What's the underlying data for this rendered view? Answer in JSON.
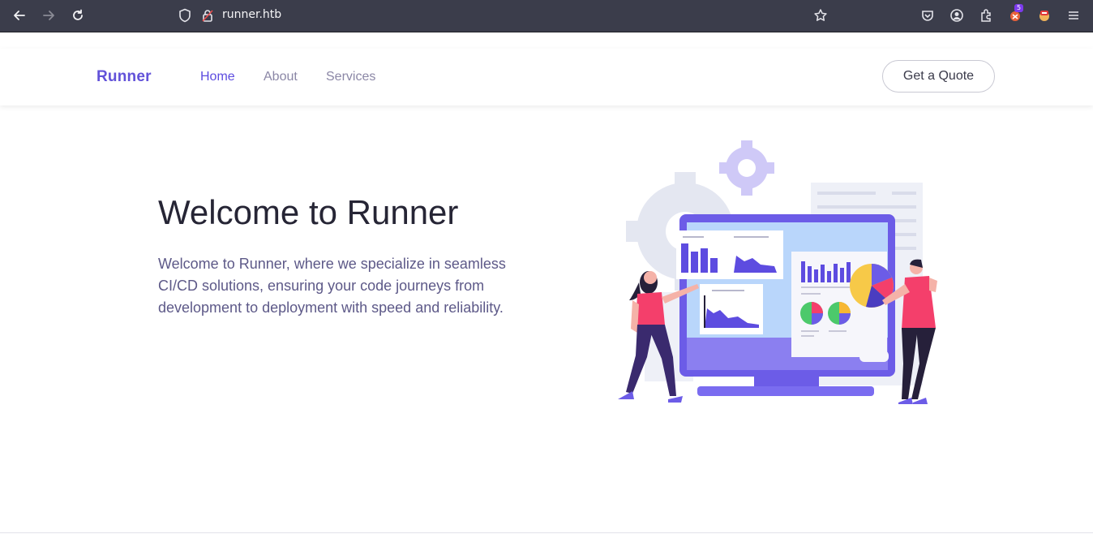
{
  "browser": {
    "url": "runner.htb",
    "extension_badge": "5",
    "icons": [
      "back-icon",
      "forward-icon",
      "reload-icon",
      "shield-icon",
      "lock-icon",
      "star-icon",
      "pocket-icon",
      "account-icon",
      "extensions-icon",
      "extension-icon",
      "extension-icon",
      "menu-icon"
    ]
  },
  "navbar": {
    "brand": "Runner",
    "links": [
      {
        "label": "Home",
        "active": true
      },
      {
        "label": "About",
        "active": false
      },
      {
        "label": "Services",
        "active": false
      }
    ],
    "cta": "Get a Quote"
  },
  "hero": {
    "title": "Welcome to Runner",
    "text": "Welcome to Runner, where we specialize in seamless CI/CD solutions, ensuring your code journeys from development to deployment with speed and reliability."
  },
  "colors": {
    "brand": "#6252d9",
    "chrome": "#3b3d4b",
    "accent_pink": "#f43f6b",
    "accent_purple": "#6c5ce7"
  }
}
